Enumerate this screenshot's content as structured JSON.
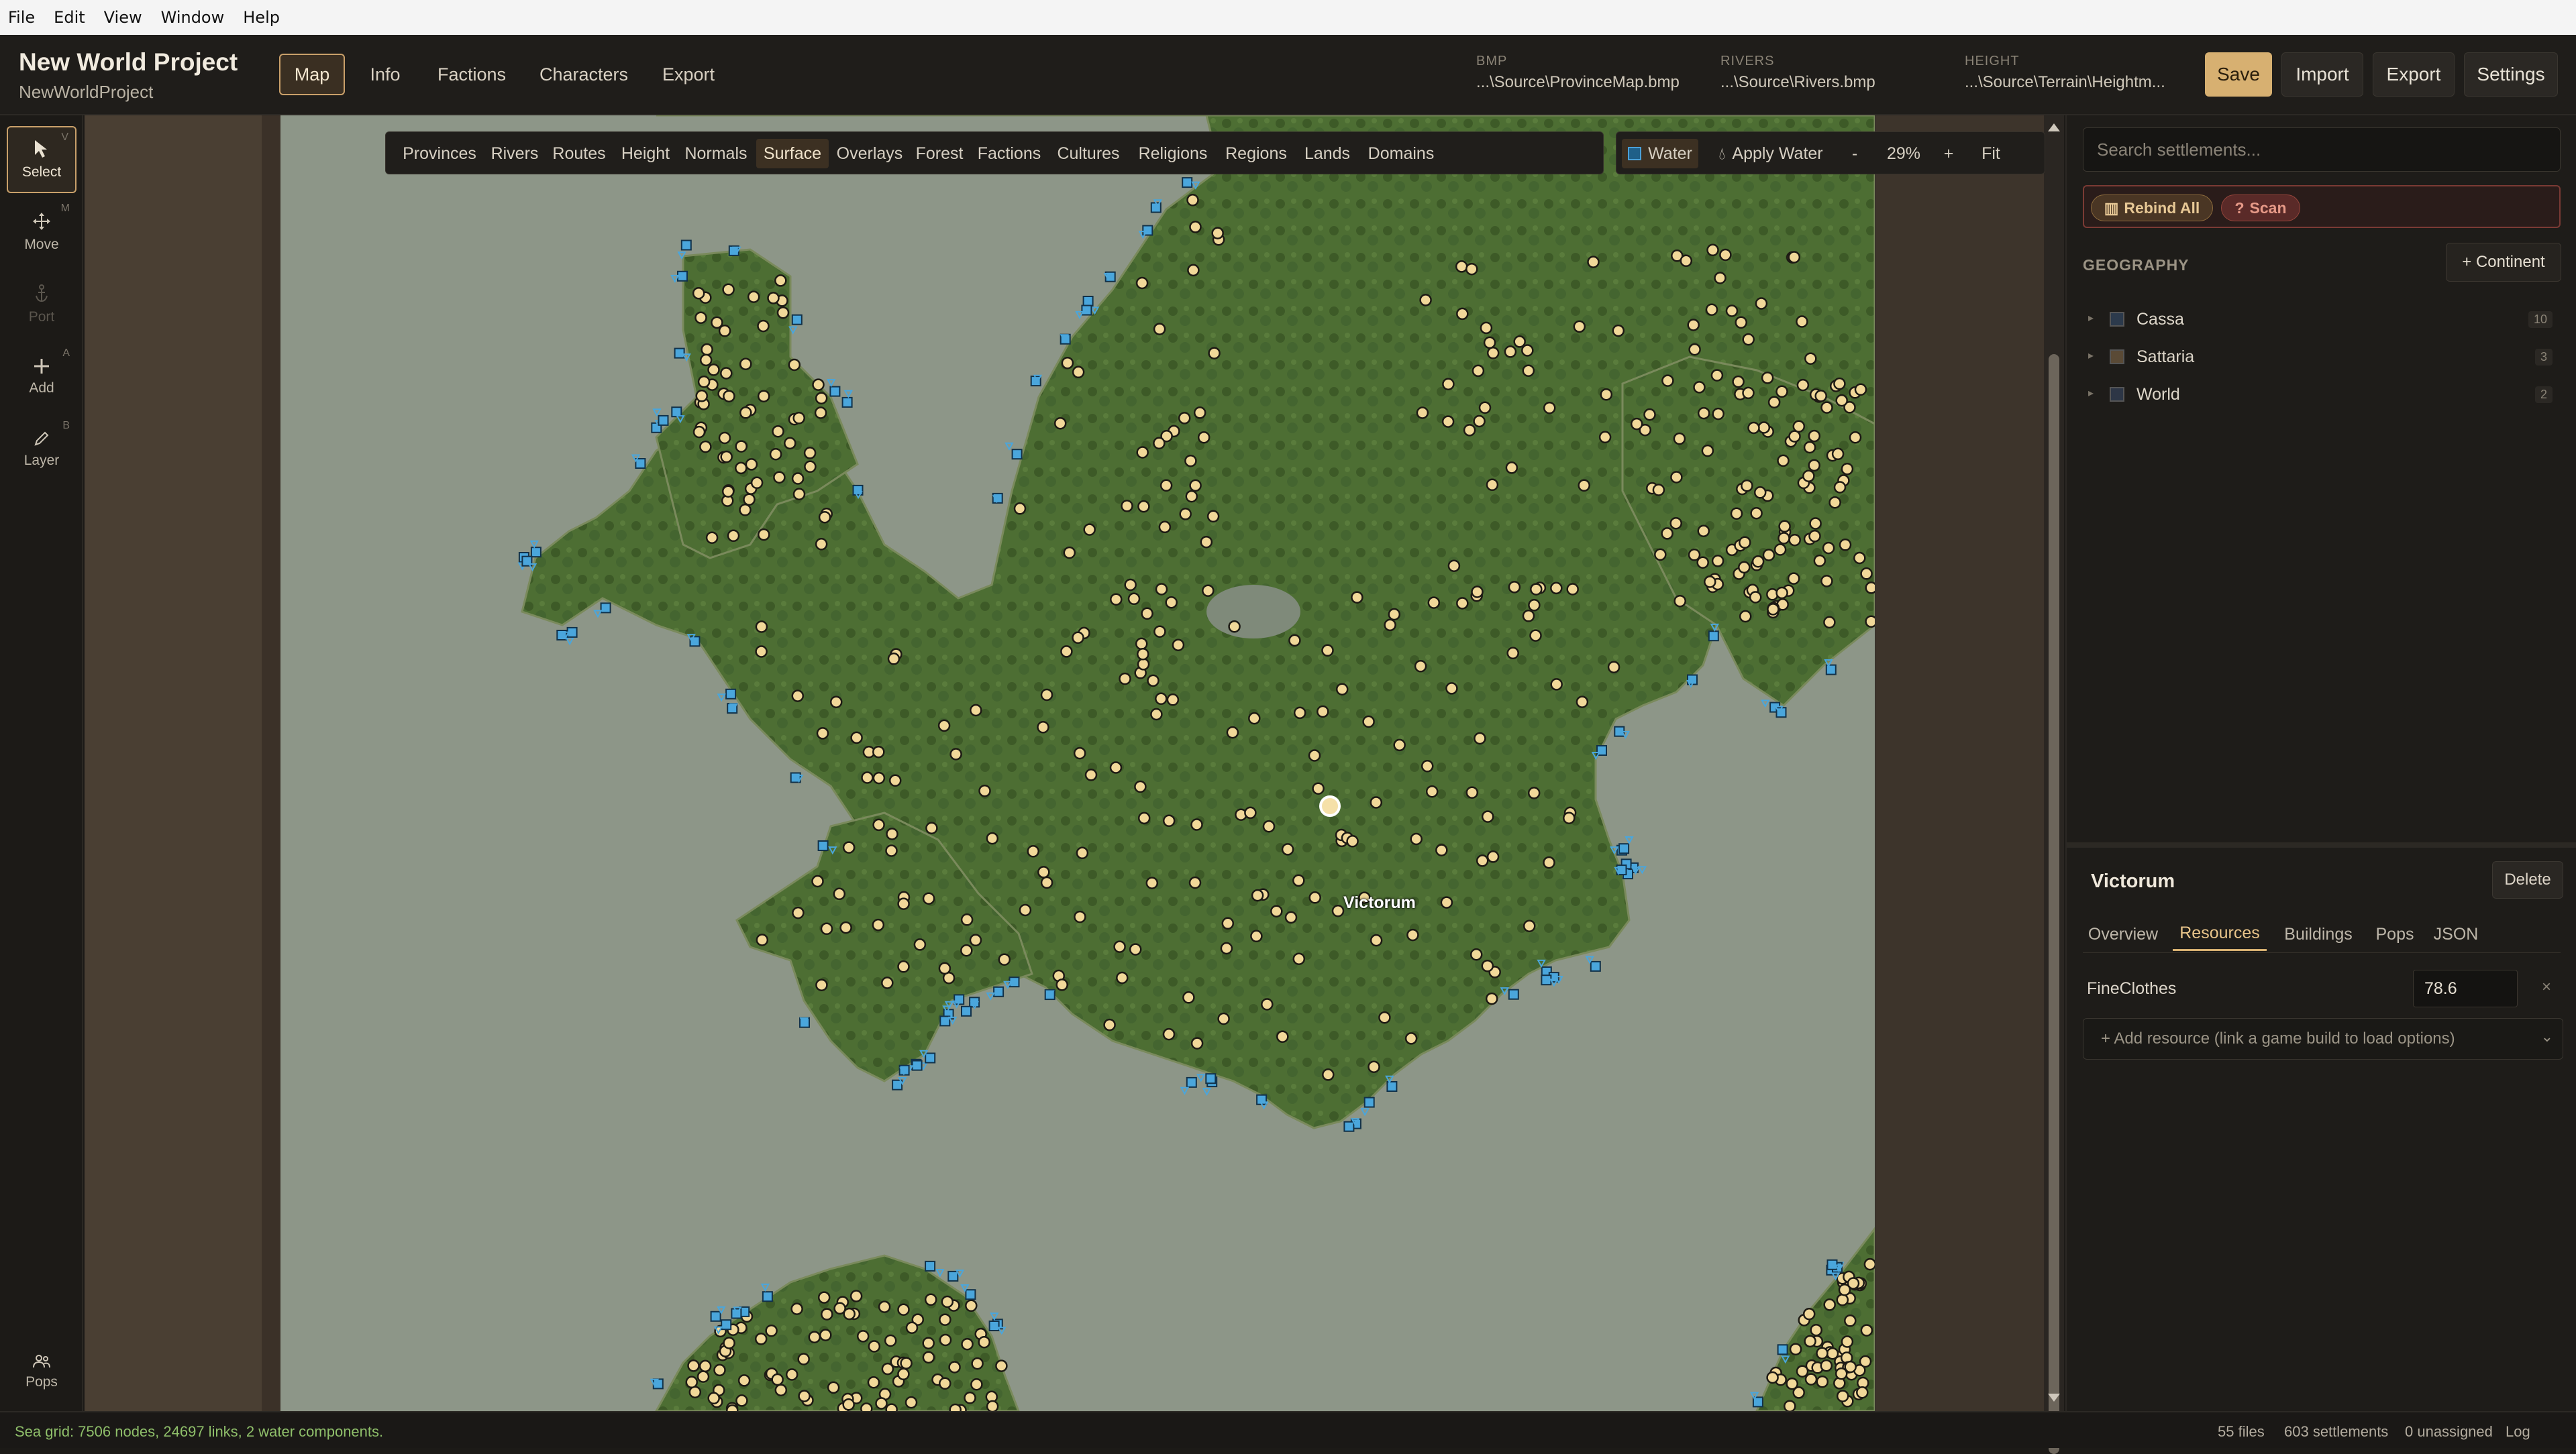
{
  "menubar": {
    "items": [
      "File",
      "Edit",
      "View",
      "Window",
      "Help"
    ]
  },
  "header": {
    "title": "New World Project",
    "subtitle": "NewWorldProject",
    "nav": [
      "Map",
      "Info",
      "Factions",
      "Characters",
      "Export"
    ],
    "active_nav": "Map",
    "paths": [
      {
        "key": "BMP",
        "value": "...\\Source\\ProvinceMap.bmp"
      },
      {
        "key": "RIVERS",
        "value": "...\\Source\\Rivers.bmp"
      },
      {
        "key": "HEIGHT",
        "value": "...\\Source\\Terrain\\Heightm..."
      }
    ],
    "buttons": {
      "save": "Save",
      "import": "Import",
      "export": "Export",
      "settings": "Settings"
    }
  },
  "tools": [
    {
      "label": "Select",
      "key": "V",
      "icon": "cursor-icon",
      "active": true
    },
    {
      "label": "Move",
      "key": "M",
      "icon": "move-icon"
    },
    {
      "label": "Port",
      "key": "",
      "icon": "anchor-icon",
      "disabled": true
    },
    {
      "label": "Add",
      "key": "A",
      "icon": "plus-icon"
    },
    {
      "label": "Layer",
      "key": "B",
      "icon": "pencil-icon"
    }
  ],
  "pops_label": "Pops",
  "layers": [
    "Provinces",
    "Rivers",
    "Routes",
    "Height",
    "Normals",
    "Surface",
    "Overlays",
    "Forest",
    "Factions",
    "Cultures",
    "Religions",
    "Regions",
    "Lands",
    "Domains"
  ],
  "active_layer": "Surface",
  "water": {
    "water_label": "Water",
    "apply_label": "Apply Water",
    "zoom_out": "-",
    "zoom": "29%",
    "zoom_in": "+",
    "fit": "Fit"
  },
  "map": {
    "selected_label": "Victorum",
    "colors": {
      "sea": "#8d9688",
      "land": "#4d6e33",
      "settlement": "#f1d899",
      "port": "#4aa6dc"
    }
  },
  "right": {
    "search_placeholder": "Search settlements...",
    "rebind_label": "Rebind All",
    "scan_label": "Scan",
    "geography_title": "GEOGRAPHY",
    "continent_btn": "+ Continent",
    "continents": [
      {
        "name": "Cassa",
        "count": "10",
        "color": "#2c3a4c"
      },
      {
        "name": "Sattaria",
        "count": "3",
        "color": "#5a4a36"
      },
      {
        "name": "World",
        "count": "2",
        "color": "#2d3646"
      }
    ],
    "selected": {
      "title": "Victorum",
      "delete": "Delete",
      "tabs": [
        "Overview",
        "Resources",
        "Buildings",
        "Pops",
        "JSON"
      ],
      "active_tab": "Resources",
      "resource_name": "FineClothes",
      "resource_value": "78.6",
      "remove": "×",
      "add_resource": "+ Add resource (link a game build to load options)"
    }
  },
  "status": {
    "left": "Sea grid: 7506 nodes, 24697 links, 2 water components.",
    "files": "55 files",
    "settlements": "603 settlements",
    "unassigned": "0 unassigned",
    "log": "Log"
  }
}
